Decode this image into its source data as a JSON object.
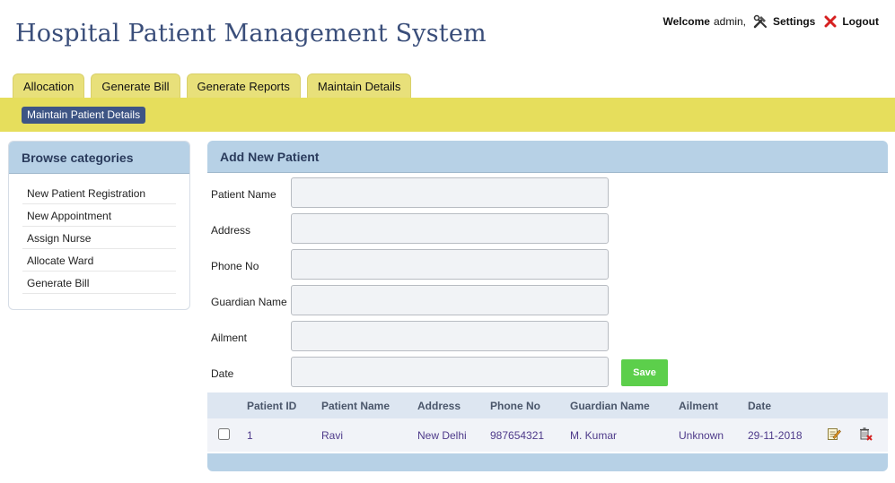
{
  "header": {
    "title": "Hospital Patient Management System",
    "welcome_label": "Welcome",
    "username": "admin,",
    "settings_label": "Settings",
    "logout_label": "Logout"
  },
  "tabs": [
    {
      "label": "Allocation"
    },
    {
      "label": "Generate Bill"
    },
    {
      "label": "Generate Reports"
    },
    {
      "label": "Maintain Details"
    }
  ],
  "subnav": {
    "active": "Maintain Patient Details"
  },
  "sidebar": {
    "title": "Browse categories",
    "items": [
      {
        "label": "New Patient Registration"
      },
      {
        "label": "New Appointment"
      },
      {
        "label": "Assign Nurse"
      },
      {
        "label": "Allocate Ward"
      },
      {
        "label": "Generate Bill"
      }
    ]
  },
  "form": {
    "title": "Add New Patient",
    "fields": [
      {
        "label": "Patient Name",
        "value": ""
      },
      {
        "label": "Address",
        "value": ""
      },
      {
        "label": "Phone No",
        "value": ""
      },
      {
        "label": "Guardian Name",
        "value": ""
      },
      {
        "label": "Ailment",
        "value": ""
      },
      {
        "label": "Date",
        "value": ""
      }
    ],
    "save_label": "Save"
  },
  "table": {
    "columns": [
      "Patient ID",
      "Patient Name",
      "Address",
      "Phone No",
      "Guardian Name",
      "Ailment",
      "Date"
    ],
    "rows": [
      {
        "id": "1",
        "name": "Ravi",
        "address": "New Delhi",
        "phone": "987654321",
        "guardian": "M. Kumar",
        "ailment": "Unknown",
        "date": "29-11-2018"
      }
    ]
  },
  "colors": {
    "title": "#3a4e7a",
    "tab_bg": "#e8e07a",
    "subnav_bg": "#e6de5c",
    "pill_bg": "#3e5585",
    "panel_head": "#b7d1e6",
    "save_btn": "#5ccf4b",
    "row_text": "#4e3a8a"
  },
  "icons": {
    "settings": "tools-icon",
    "logout": "red-x-icon",
    "edit": "edit-icon",
    "delete": "delete-icon"
  }
}
